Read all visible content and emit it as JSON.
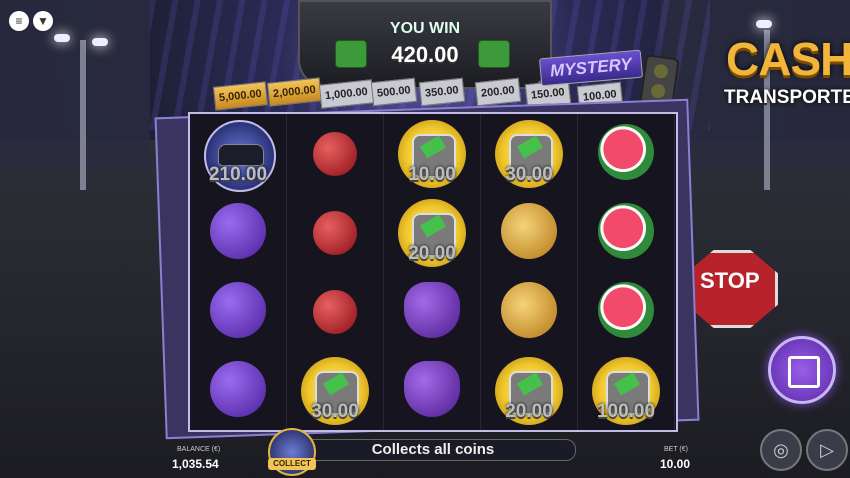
{
  "top_icons": {
    "menu": "≡",
    "brand": "▼"
  },
  "win": {
    "title": "YOU WIN",
    "amount": "420.00"
  },
  "jackpots": [
    "5,000.00",
    "2,000.00",
    "1,000.00",
    "500.00",
    "350.00",
    "200.00",
    "150.00",
    "100.00"
  ],
  "mystery": "MYSTERY",
  "logo": {
    "line1": "CASH",
    "line2": "TRANSPORTER"
  },
  "stop_sign": "STOP",
  "reels": [
    [
      {
        "type": "car",
        "value": "210.00"
      },
      {
        "type": "plum"
      },
      {
        "type": "plum"
      },
      {
        "type": "plum"
      }
    ],
    [
      {
        "type": "cherry"
      },
      {
        "type": "cherry"
      },
      {
        "type": "cherry"
      },
      {
        "type": "coin",
        "value": "30.00"
      }
    ],
    [
      {
        "type": "coin",
        "value": "10.00"
      },
      {
        "type": "coin",
        "value": "20.00"
      },
      {
        "type": "grapes"
      },
      {
        "type": "grapes"
      }
    ],
    [
      {
        "type": "coin",
        "value": "30.00"
      },
      {
        "type": "lemon"
      },
      {
        "type": "lemon"
      },
      {
        "type": "coin",
        "value": "20.00"
      }
    ],
    [
      {
        "type": "melon"
      },
      {
        "type": "melon"
      },
      {
        "type": "melon"
      },
      {
        "type": "coin",
        "value": "100.00"
      }
    ]
  ],
  "bottom": {
    "balance_label": "BALANCE (€)",
    "balance_value": "1,035.54",
    "collect_label": "COLLECT",
    "message": "Collects all coins",
    "bet_label": "BET (€)",
    "bet_value": "10.00"
  },
  "buttons": {
    "stake_icon": "coins-icon",
    "autoplay_icon": "autoplay-icon"
  }
}
